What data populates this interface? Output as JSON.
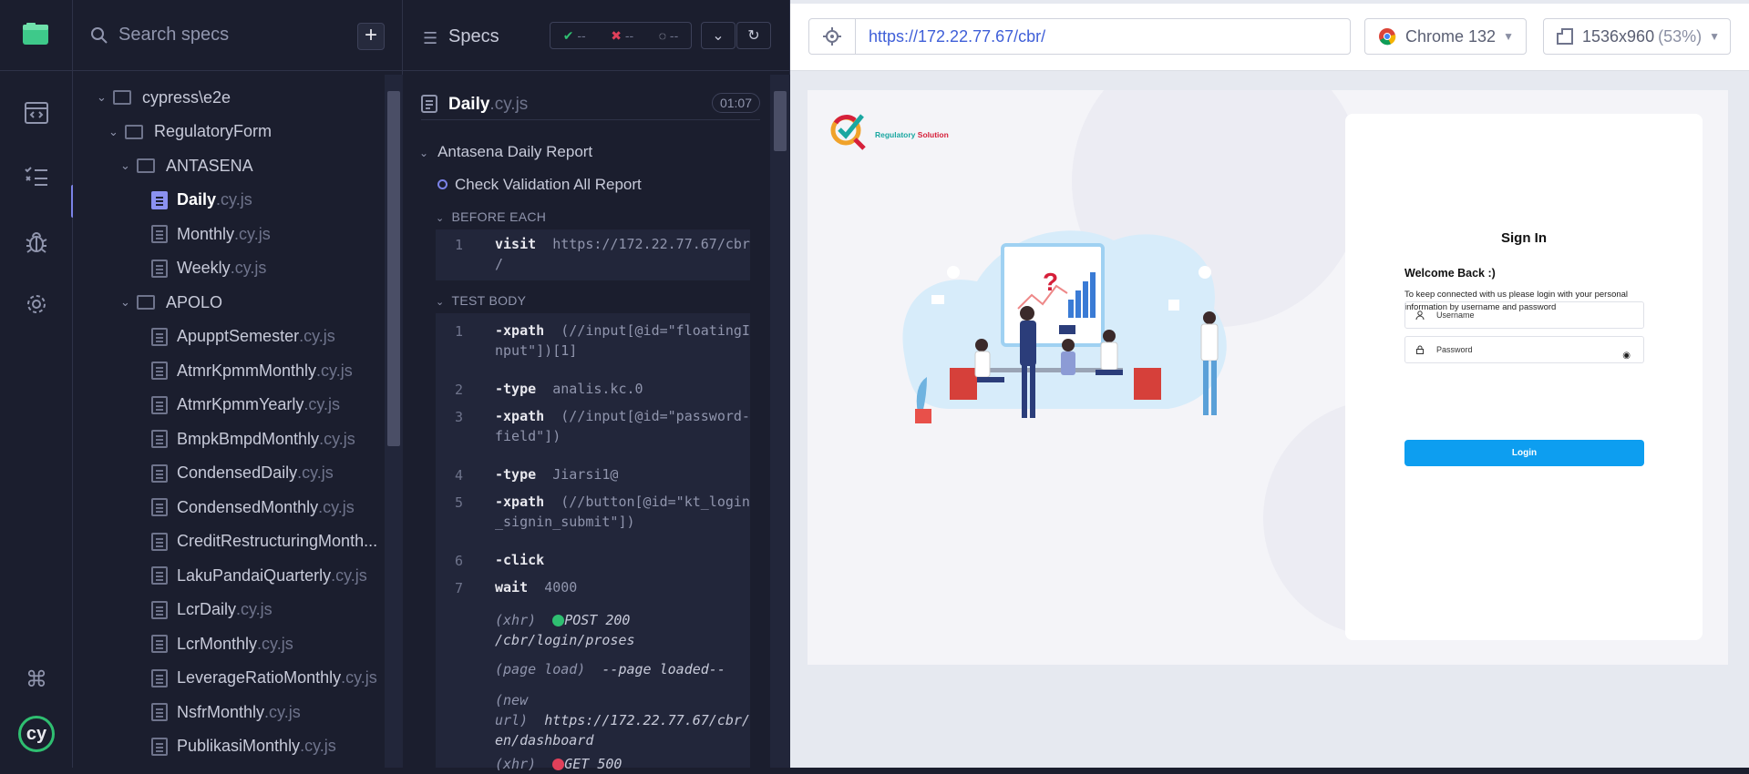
{
  "nav": {
    "icons": [
      "runs-icon",
      "specs-list-icon",
      "debug-icon",
      "settings-icon"
    ]
  },
  "specs_panel": {
    "search_placeholder": "Search specs",
    "add_label": "+",
    "tree": [
      {
        "type": "folder",
        "name": "cypress\\e2e",
        "ext": ""
      },
      {
        "type": "folder",
        "name": "RegulatoryForm",
        "ext": ""
      },
      {
        "type": "folder",
        "name": "ANTASENA",
        "ext": ""
      },
      {
        "type": "file",
        "name": "Daily",
        "ext": ".cy.js",
        "selected": true
      },
      {
        "type": "file",
        "name": "Monthly",
        "ext": ".cy.js"
      },
      {
        "type": "file",
        "name": "Weekly",
        "ext": ".cy.js"
      },
      {
        "type": "folder",
        "name": "APOLO",
        "ext": ""
      },
      {
        "type": "file",
        "name": "ApupptSemester",
        "ext": ".cy.js"
      },
      {
        "type": "file",
        "name": "AtmrKpmmMonthly",
        "ext": ".cy.js"
      },
      {
        "type": "file",
        "name": "AtmrKpmmYearly",
        "ext": ".cy.js"
      },
      {
        "type": "file",
        "name": "BmpkBmpdMonthly",
        "ext": ".cy.js"
      },
      {
        "type": "file",
        "name": "CondensedDaily",
        "ext": ".cy.js"
      },
      {
        "type": "file",
        "name": "CondensedMonthly",
        "ext": ".cy.js"
      },
      {
        "type": "file",
        "name": "CreditRestructuringMonth...",
        "ext": ""
      },
      {
        "type": "file",
        "name": "LakuPandaiQuarterly",
        "ext": ".cy.js"
      },
      {
        "type": "file",
        "name": "LcrDaily",
        "ext": ".cy.js"
      },
      {
        "type": "file",
        "name": "LcrMonthly",
        "ext": ".cy.js"
      },
      {
        "type": "file",
        "name": "LeverageRatioMonthly",
        "ext": ".cy.js"
      },
      {
        "type": "file",
        "name": "NsfrMonthly",
        "ext": ".cy.js"
      },
      {
        "type": "file",
        "name": "PublikasiMonthly",
        "ext": ".cy.js"
      }
    ]
  },
  "reporter": {
    "title": "Specs",
    "stats": {
      "passed": "--",
      "failed": "--",
      "pending": "--"
    },
    "file": {
      "name": "Daily",
      "ext": ".cy.js",
      "duration": "01:07"
    },
    "suite": "Antasena Daily Report",
    "test": "Check Validation All Report",
    "before_each_label": "BEFORE EACH",
    "test_body_label": "TEST BODY",
    "before_each": [
      {
        "num": "1",
        "name": "visit",
        "arg": "https://172.22.77.67/cbr",
        "arg2": "/"
      }
    ],
    "body": [
      {
        "num": "1",
        "name": "-xpath",
        "arg": "(//input[@id=\"floatingI",
        "arg2": "nput\"])[1]"
      },
      {
        "num": "2",
        "name": "-type",
        "arg": "analis.kc.0",
        "arg2": ""
      },
      {
        "num": "3",
        "name": "-xpath",
        "arg": "(//input[@id=\"password-",
        "arg2": "field\"])"
      },
      {
        "num": "4",
        "name": "-type",
        "arg": "Jiarsi1@",
        "arg2": ""
      },
      {
        "num": "5",
        "name": "-xpath",
        "arg": "(//button[@id=\"kt_login",
        "arg2": "_signin_submit\"])"
      },
      {
        "num": "6",
        "name": "-click",
        "arg": "",
        "arg2": ""
      },
      {
        "num": "7",
        "name": "wait",
        "arg": "4000",
        "arg2": ""
      }
    ],
    "events": [
      {
        "tag": "(xhr)",
        "status": "POST 200",
        "path": "/cbr/login/proses"
      },
      {
        "tag": "(page load)",
        "text": "--page loaded--"
      },
      {
        "tag": "(new",
        "tag2": "url)",
        "text": "https://172.22.77.67/cbr/",
        "text2": "en/dashboard"
      },
      {
        "tag": "(xhr)",
        "status": "GET 500"
      }
    ]
  },
  "aut": {
    "url": "https://172.22.77.67/cbr/",
    "browser": "Chrome 132",
    "viewport": "1536x960",
    "zoom": "(53%)"
  },
  "app": {
    "brand_a": "Regulatory",
    "brand_b": "Solution",
    "sign_in": "Sign In",
    "welcome": "Welcome Back :)",
    "description": "To keep connected with us please login with your personal information by username and password",
    "username_placeholder": "Username",
    "password_placeholder": "Password",
    "login_label": "Login"
  },
  "colors": {
    "accent": "#7b83e8",
    "pass": "#2fbf71",
    "fail": "#e0405a",
    "login_button": "#0d9ef0"
  }
}
